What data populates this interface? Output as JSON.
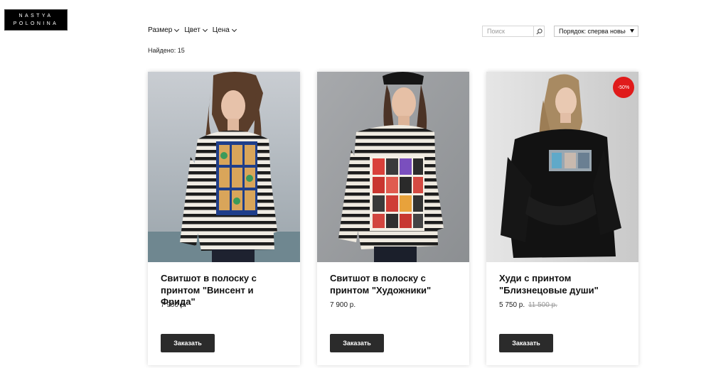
{
  "brand": {
    "line1": "NASTYA",
    "line2": "POLONINA"
  },
  "filters": [
    {
      "label": "Размер"
    },
    {
      "label": "Цвет"
    },
    {
      "label": "Цена"
    }
  ],
  "search": {
    "placeholder": "Поиск"
  },
  "sort": {
    "selected": "Порядок: сперва новые"
  },
  "found": "Найдено: 15",
  "products": [
    {
      "title": "Свитшот в полоску с принтом \"Винсент и Фрида\"",
      "price": "7 900 р.",
      "button": "Заказать"
    },
    {
      "title": "Свитшот в полоску с принтом \"Художники\"",
      "price": "7 900 р.",
      "button": "Заказать"
    },
    {
      "title": "Худи с принтом \"Близнецовые души\"",
      "price": "5 750 р.",
      "old_price": "11 500 р.",
      "badge": "-50%",
      "button": "Заказать"
    }
  ],
  "colors": {
    "button_bg": "#2b2b2b",
    "badge_bg": "#e01b1b"
  }
}
